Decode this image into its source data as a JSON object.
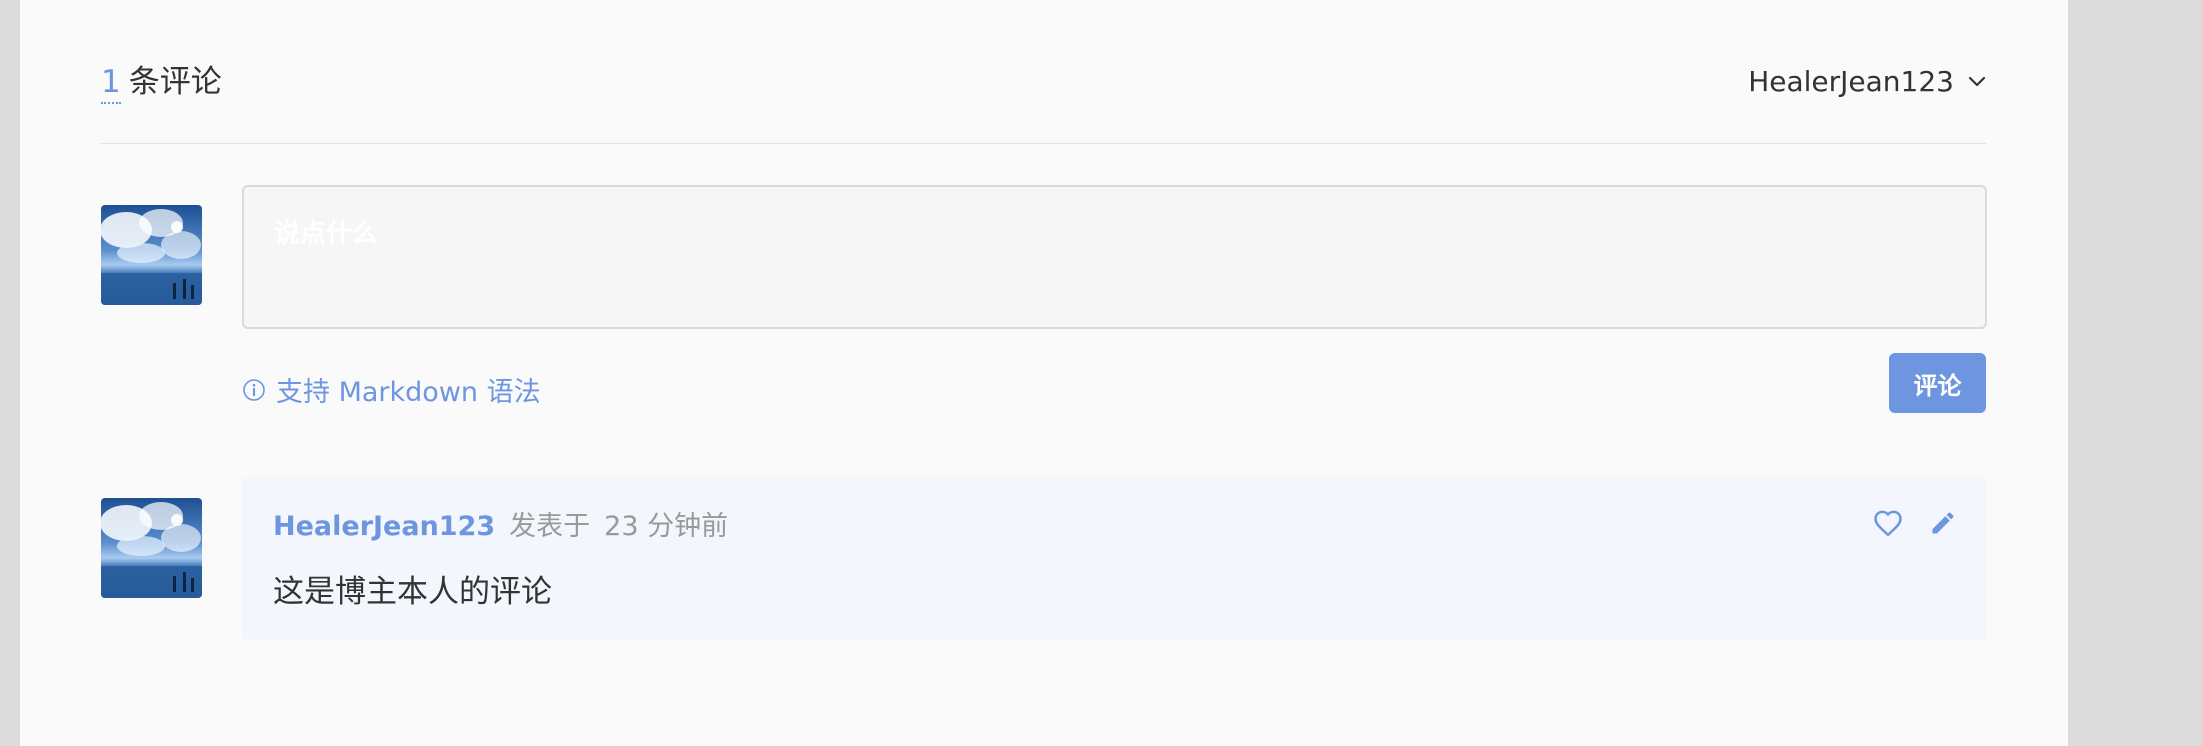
{
  "header": {
    "count": "1",
    "count_label": "条评论",
    "user_name": "HealerJean123"
  },
  "editor": {
    "placeholder": "说点什么",
    "markdown_hint": "支持 Markdown 语法",
    "submit_label": "评论"
  },
  "comments": [
    {
      "author": "HealerJean123",
      "posted_label": "发表于",
      "time": "23 分钟前",
      "body": "这是博主本人的评论"
    }
  ],
  "colors": {
    "accent": "#6d95e0",
    "page_bg": "#fafafa",
    "outer_bg": "#dcdcdc",
    "card_bg": "#f3f6fc"
  },
  "icons": {
    "dropdown": "chevron-down-icon",
    "info": "info-icon",
    "like": "heart-icon",
    "edit": "pencil-icon"
  }
}
